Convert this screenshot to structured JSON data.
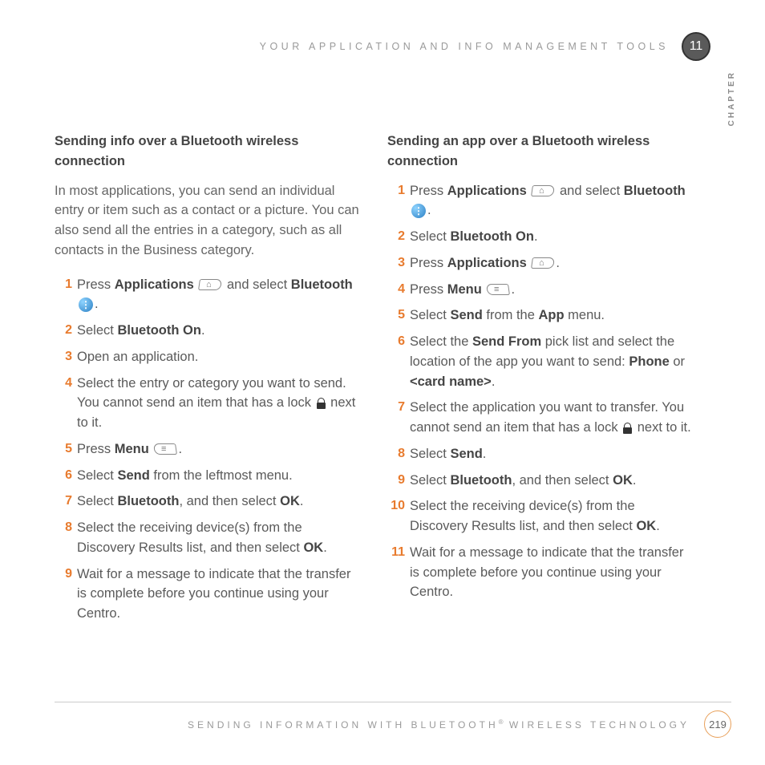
{
  "header": {
    "title": "YOUR APPLICATION AND INFO MANAGEMENT TOOLS",
    "chapter_number": "11",
    "chapter_label": "CHAPTER"
  },
  "left": {
    "title": "Sending info over a Bluetooth wireless connection",
    "intro": "In most applications, you can send an individual entry or item such as a contact or a picture. You can also send all the entries in a category, such as all contacts in the Business category.",
    "steps": {
      "s1a": "Press ",
      "s1b": "Applications",
      "s1c": " and select ",
      "s1d": "Bluetooth",
      "s1e": ".",
      "s2a": "Select ",
      "s2b": "Bluetooth On",
      "s2c": ".",
      "s3": "Open an application.",
      "s4": "Select the entry or category you want to send. You cannot send an item that has a lock ",
      "s4b": " next to it.",
      "s5a": "Press ",
      "s5b": "Menu",
      "s5c": ".",
      "s6a": "Select ",
      "s6b": "Send",
      "s6c": " from the leftmost menu.",
      "s7a": "Select ",
      "s7b": "Bluetooth",
      "s7c": ", and then select ",
      "s7d": "OK",
      "s7e": ".",
      "s8a": "Select the receiving device(s) from the Discovery Results list, and then select ",
      "s8b": "OK",
      "s8c": ".",
      "s9": "Wait for a message to indicate that the transfer is complete before you continue using your Centro."
    }
  },
  "right": {
    "title": "Sending an app over a Bluetooth wireless connection",
    "steps": {
      "s1a": "Press ",
      "s1b": "Applications",
      "s1c": " and select ",
      "s1d": "Bluetooth",
      "s1e": ".",
      "s2a": "Select ",
      "s2b": "Bluetooth On",
      "s2c": ".",
      "s3a": "Press ",
      "s3b": "Applications",
      "s3c": ".",
      "s4a": "Press ",
      "s4b": "Menu",
      "s4c": ".",
      "s5a": "Select ",
      "s5b": "Send",
      "s5c": " from the ",
      "s5d": "App",
      "s5e": " menu.",
      "s6a": "Select the ",
      "s6b": "Send From",
      "s6c": " pick list and select the location of the app you want to send: ",
      "s6d": "Phone",
      "s6e": " or ",
      "s6f": "<card name>",
      "s6g": ".",
      "s7a": "Select the application you want to transfer. You cannot send an item that has a lock ",
      "s7b": " next to it.",
      "s8a": "Select ",
      "s8b": "Send",
      "s8c": ".",
      "s9a": "Select ",
      "s9b": "Bluetooth",
      "s9c": ", and then select ",
      "s9d": "OK",
      "s9e": ".",
      "s10a": "Select the receiving device(s) from the Discovery Results list, and then select ",
      "s10b": "OK",
      "s10c": ".",
      "s11": "Wait for a message to indicate that the transfer is complete before you continue using your Centro."
    }
  },
  "footer": {
    "title_before": "SENDING INFORMATION WITH BLUETOOTH",
    "title_after": " WIRELESS TECHNOLOGY",
    "reg": "®",
    "page_number": "219"
  }
}
